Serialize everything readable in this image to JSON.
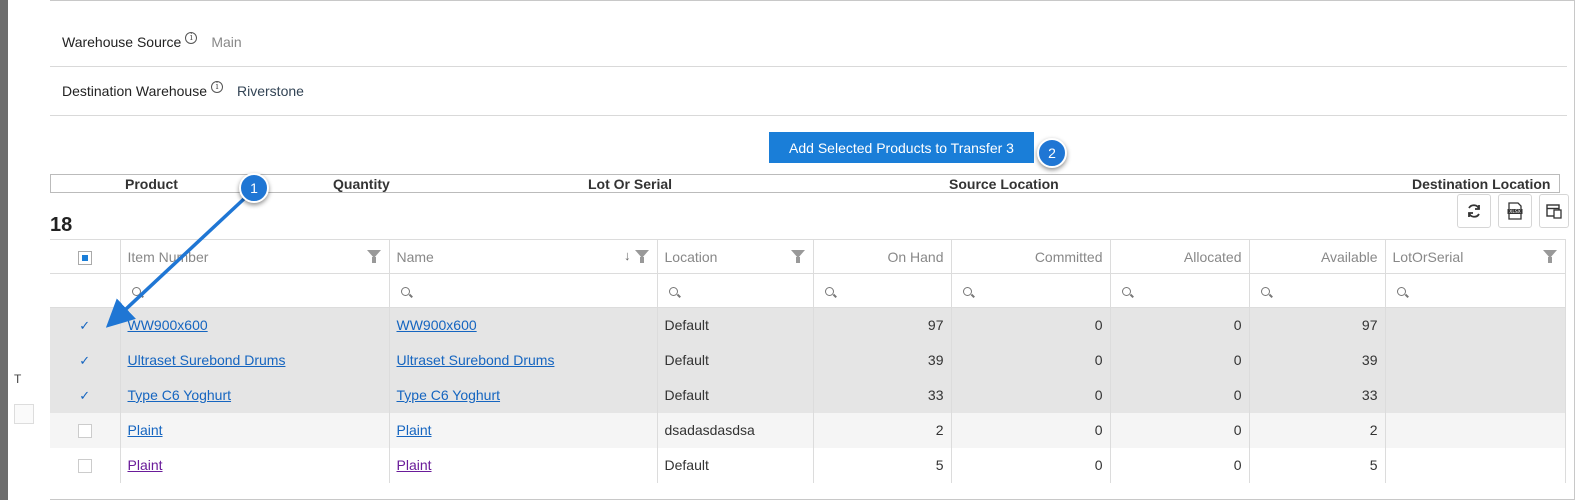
{
  "warehouse_source": {
    "label": "Warehouse Source",
    "value": "Main"
  },
  "destination_warehouse": {
    "label": "Destination Warehouse",
    "value": "Riverstone"
  },
  "add_button": {
    "label": "Add Selected Products to Transfer 3"
  },
  "callouts": {
    "one": "1",
    "two": "2"
  },
  "transfer_columns": {
    "product": "Product",
    "quantity": "Quantity",
    "lot": "Lot Or Serial",
    "source": "Source Location",
    "destination": "Destination Location"
  },
  "record_count": "18",
  "toolbar": {
    "refresh_icon": "refresh-icon",
    "export_icon": "xlsx-export-icon",
    "columns_icon": "column-chooser-icon"
  },
  "grid": {
    "headers": {
      "item_number": "Item Number",
      "name": "Name",
      "location": "Location",
      "on_hand": "On Hand",
      "committed": "Committed",
      "allocated": "Allocated",
      "available": "Available",
      "lot_or_serial": "LotOrSerial"
    },
    "rows": [
      {
        "checked": true,
        "item_number": "WW900x600",
        "name": "WW900x600",
        "location": "Default",
        "on_hand": "97",
        "committed": "0",
        "allocated": "0",
        "available": "97",
        "lot_or_serial": ""
      },
      {
        "checked": true,
        "item_number": "Ultraset Surebond Drums",
        "name": "Ultraset Surebond Drums",
        "location": "Default",
        "on_hand": "39",
        "committed": "0",
        "allocated": "0",
        "available": "39",
        "lot_or_serial": ""
      },
      {
        "checked": true,
        "item_number": "Type C6 Yoghurt",
        "name": "Type C6 Yoghurt",
        "location": "Default",
        "on_hand": "33",
        "committed": "0",
        "allocated": "0",
        "available": "33",
        "lot_or_serial": ""
      },
      {
        "checked": false,
        "item_number": "Plaint",
        "name": "Plaint",
        "location": "dsadasdasdsa",
        "on_hand": "2",
        "committed": "0",
        "allocated": "0",
        "available": "2",
        "lot_or_serial": ""
      },
      {
        "checked": false,
        "item_number": "Plaint",
        "name": "Plaint",
        "location": "Default",
        "on_hand": "5",
        "committed": "0",
        "allocated": "0",
        "available": "5",
        "lot_or_serial": ""
      }
    ]
  },
  "colors": {
    "accent": "#1a7ed8",
    "callout": "#1f76d4",
    "link": "#1565c0",
    "visited_link": "#6a1b9a",
    "selected_row": "#e5e5e5"
  }
}
